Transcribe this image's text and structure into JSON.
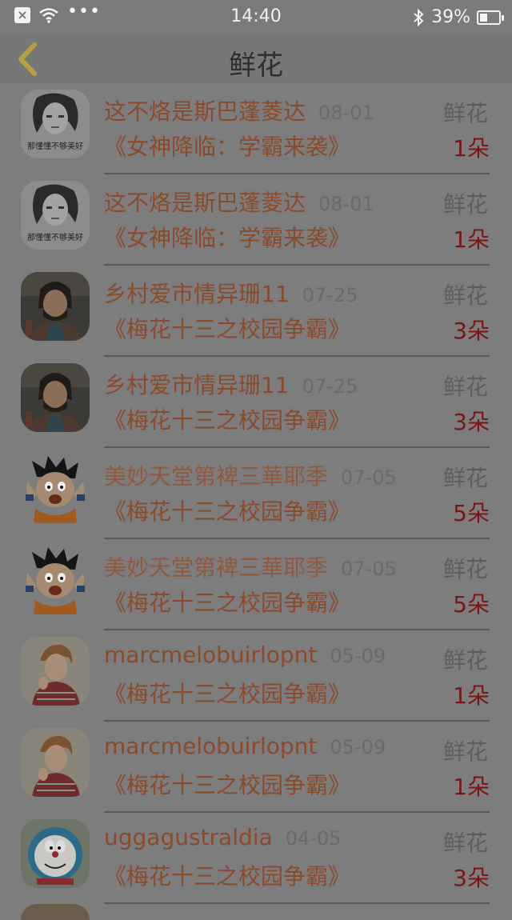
{
  "status_bar": {
    "time": "14:40",
    "battery": "39%",
    "battery_level": 0.39,
    "icons": [
      "close-box-icon",
      "wifi-icon",
      "more-dots-icon",
      "bluetooth-icon",
      "battery-icon"
    ]
  },
  "nav": {
    "title": "鲜花",
    "back_icon": "chevron-left-icon",
    "back_color": "#b8a040"
  },
  "colors": {
    "name": "#8a4a2c",
    "count": "#7a1616",
    "label": "#5e5e5e"
  },
  "items": [
    {
      "name": "这不烙是斯巴蓬菱达",
      "date": "08-01",
      "label": "鲜花",
      "book": "《女神降临：学霸来袭》",
      "count": "1朵",
      "avatar": "avatar-girl-sketch"
    },
    {
      "name": "这不烙是斯巴蓬菱达",
      "date": "08-01",
      "label": "鲜花",
      "book": "《女神降临：学霸来袭》",
      "count": "1朵",
      "avatar": "avatar-girl-sketch"
    },
    {
      "name": "乡村爱市情异珊11",
      "date": "07-25",
      "label": "鲜花",
      "book": "《梅花十三之校园争霸》",
      "count": "3朵",
      "avatar": "avatar-bearded-man"
    },
    {
      "name": "乡村爱市情异珊11",
      "date": "07-25",
      "label": "鲜花",
      "book": "《梅花十三之校园争霸》",
      "count": "3朵",
      "avatar": "avatar-bearded-man"
    },
    {
      "name": "美妙天堂第裨三華耶季",
      "date": "07-05",
      "label": "鲜花",
      "book": "《梅花十三之校园争霸》",
      "count": "5朵",
      "avatar": "avatar-cartoon-goku"
    },
    {
      "name": "美妙天堂第裨三華耶季",
      "date": "07-05",
      "label": "鲜花",
      "book": "《梅花十三之校园争霸》",
      "count": "5朵",
      "avatar": "avatar-cartoon-goku"
    },
    {
      "name": "marcmelobuirlopnt",
      "date": "05-09",
      "label": "鲜花",
      "book": "《梅花十三之校园争霸》",
      "count": "1朵",
      "avatar": "avatar-young-man"
    },
    {
      "name": "marcmelobuirlopnt",
      "date": "05-09",
      "label": "鲜花",
      "book": "《梅花十三之校园争霸》",
      "count": "1朵",
      "avatar": "avatar-young-man"
    },
    {
      "name": "uggagustraldia",
      "date": "04-05",
      "label": "鲜花",
      "book": "《梅花十三之校园争霸》",
      "count": "3朵",
      "avatar": "avatar-doraemon-clock"
    }
  ]
}
